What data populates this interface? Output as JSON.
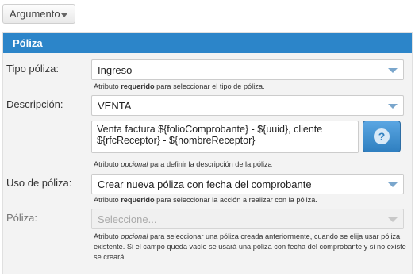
{
  "toolbar": {
    "argument_button": "Argumento"
  },
  "panel": {
    "title": "Póliza"
  },
  "fields": {
    "tipo_poliza": {
      "label": "Tipo póliza:",
      "value": "Ingreso",
      "hint_pre": "Atributo ",
      "hint_emph": "requerido",
      "hint_post": " para seleccionar el tipo de póliza."
    },
    "descripcion": {
      "label": "Descripción:",
      "value": "VENTA",
      "text_line1": "Venta factura ${folioComprobante} - ${uuid}, cliente",
      "text_line2": "${rfcReceptor} - ${nombreReceptor}",
      "help_glyph": "?",
      "hint_pre": "Atributo ",
      "hint_emph": "opcional",
      "hint_post": " para definir la descripción de la póliza"
    },
    "uso_poliza": {
      "label": "Uso de póliza:",
      "value": "Crear nueva póliza con fecha del comprobante",
      "hint_pre": "Atributo ",
      "hint_emph": "requerido",
      "hint_post": " para seleccionar la acción a realizar con la póliza."
    },
    "poliza": {
      "label": "Póliza:",
      "placeholder": "Seleccione...",
      "hint_pre": "Atributo ",
      "hint_emph": "opcional",
      "hint_post": " para seleccionar una póliza creada anteriormente, cuando se elija usar póliza existente. Si el campo queda vacío se usará una póliza con fecha del comprobante y si no existe se creará."
    }
  },
  "colors": {
    "header_bg": "#2c85c9",
    "panel_bg": "#f3f3f3",
    "help_button": "#3a8bd0"
  },
  "icons": {
    "dropdown": "chevron-down-icon",
    "help": "question-icon"
  }
}
